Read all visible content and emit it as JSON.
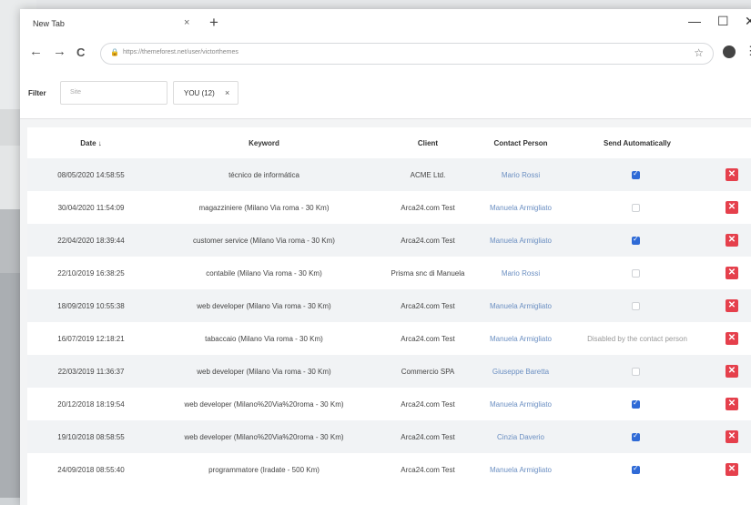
{
  "browser": {
    "tab_title": "New Tab",
    "tab_close": "×",
    "new_tab": "+",
    "minimize": "—",
    "maximize": "☐",
    "close": "✕",
    "back": "←",
    "forward": "→",
    "reload": "C",
    "url": "https://themeforest.net/user/victorthemes",
    "star": "☆",
    "menu": "⋮"
  },
  "filter": {
    "label": "Filter",
    "placeholder": "Site",
    "chip_label": "YOU (12)",
    "chip_remove": "×"
  },
  "table": {
    "headers": {
      "date": "Date ↓",
      "keyword": "Keyword",
      "client": "Client",
      "contact": "Contact Person",
      "send": "Send Automatically"
    },
    "rows": [
      {
        "date": "08/05/2020 14:58:55",
        "keyword": "técnico de informática",
        "client": "ACME Ltd.",
        "contact": "Mario Rossi",
        "send": "checked"
      },
      {
        "date": "30/04/2020 11:54:09",
        "keyword": "magazziniere (Milano Via roma - 30 Km)",
        "client": "Arca24.com Test",
        "contact": "Manuela Armigliato",
        "send": "unchecked"
      },
      {
        "date": "22/04/2020 18:39:44",
        "keyword": "customer service (Milano Via roma - 30 Km)",
        "client": "Arca24.com Test",
        "contact": "Manuela Armigliato",
        "send": "checked"
      },
      {
        "date": "22/10/2019 16:38:25",
        "keyword": "contabile (Milano Via roma - 30 Km)",
        "client": "Prisma snc di Manuela",
        "contact": "Mario Rossi",
        "send": "unchecked"
      },
      {
        "date": "18/09/2019 10:55:38",
        "keyword": "web developer (Milano Via roma - 30 Km)",
        "client": "Arca24.com Test",
        "contact": "Manuela Armigliato",
        "send": "unchecked"
      },
      {
        "date": "16/07/2019 12:18:21",
        "keyword": "tabaccaio (Milano Via roma - 30 Km)",
        "client": "Arca24.com Test",
        "contact": "Manuela Armigliato",
        "send": "Disabled by the contact person"
      },
      {
        "date": "22/03/2019 11:36:37",
        "keyword": "web developer (Milano Via roma - 30 Km)",
        "client": "Commercio SPA",
        "contact": "Giuseppe Baretta",
        "send": "unchecked"
      },
      {
        "date": "20/12/2018 18:19:54",
        "keyword": "web developer (Milano%20Via%20roma - 30 Km)",
        "client": "Arca24.com Test",
        "contact": "Manuela Armigliato",
        "send": "checked"
      },
      {
        "date": "19/10/2018 08:58:55",
        "keyword": "web developer (Milano%20Via%20roma - 30 Km)",
        "client": "Arca24.com Test",
        "contact": "Cinzia Daverio",
        "send": "checked"
      },
      {
        "date": "24/09/2018 08:55:40",
        "keyword": "programmatore (Iradate - 500 Km)",
        "client": "Arca24.com Test",
        "contact": "Manuela Armigliato",
        "send": "checked"
      }
    ],
    "delete_symbol": "✕"
  },
  "colors": {
    "accent": "#2f6ad6",
    "delete": "#e5404c",
    "contact_link": "#6b8fc2",
    "row_stripe": "#f1f3f5"
  }
}
